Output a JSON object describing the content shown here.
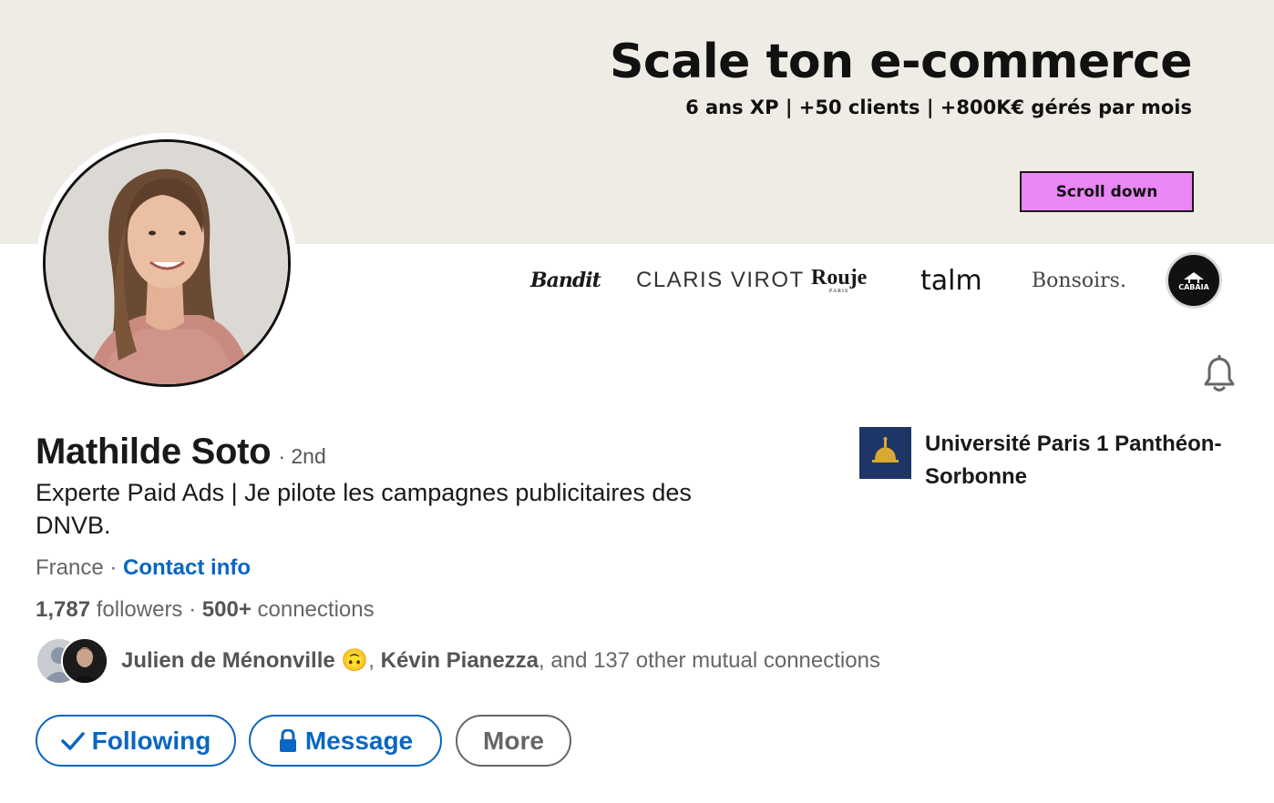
{
  "banner": {
    "title": "Scale ton e-commerce",
    "subtitle": "6 ans XP | +50 clients | +800K€ gérés par mois",
    "cta_label": "Scroll down",
    "cta_color": "#ea86f5",
    "background_color": "#efece6"
  },
  "brand_logos": [
    {
      "name": "Bandit"
    },
    {
      "name": "CLARIS VIROT"
    },
    {
      "name": "Rouje",
      "sub": "PARIS"
    },
    {
      "name": "talm"
    },
    {
      "name": "Bonsoirs."
    },
    {
      "name": "CABAIA"
    }
  ],
  "profile": {
    "name": "Mathilde Soto",
    "degree": "· 2nd",
    "headline": "Experte Paid Ads | Je pilote les campagnes publicitaires des DNVB.",
    "location": "France",
    "location_separator": " · ",
    "contact_label": "Contact info",
    "followers_count": "1,787",
    "followers_label": " followers",
    "stats_separator": " · ",
    "connections_count": "500+",
    "connections_label": " connections"
  },
  "mutuals": {
    "name1": "Julien de Ménonville",
    "emoji": "🙃",
    "comma": ",",
    "name2": "Kévin Pianezza",
    "rest": ", and 137 other mutual connections"
  },
  "education": {
    "school": "Université Paris 1 Panthéon-Sorbonne"
  },
  "actions": {
    "following_label": "Following",
    "message_label": "Message",
    "more_label": "More"
  },
  "colors": {
    "link_blue": "#0a66c2",
    "text_primary": "#191919",
    "text_secondary": "#666666",
    "school_logo": "#1e3567"
  },
  "icons": {
    "following": "checkmark-icon",
    "message": "lock-icon",
    "notify": "bell-icon"
  }
}
